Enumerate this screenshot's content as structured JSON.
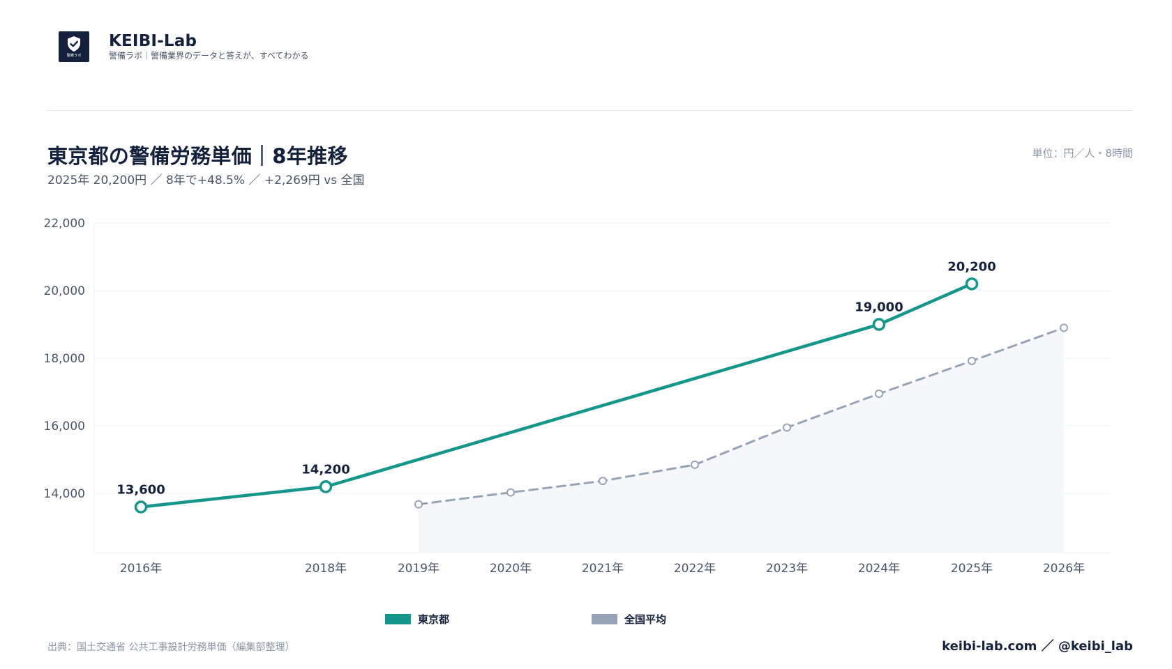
{
  "brand": {
    "name": "KEIBI-Lab",
    "tagline": "警備ラボ｜警備業界のデータと答えが、すべてわかる",
    "logo_text": "警備ラボ",
    "logo_icon": "shield-check-icon",
    "logo_bg": "#14213d"
  },
  "chart_header": {
    "title": "東京都の警備労務単価｜8年推移",
    "subtitle": "2025年 20,200円 ／ 8年で+48.5% ／ +2,269円 vs 全国",
    "unit": "単位：円／人・8時間"
  },
  "chart_data": {
    "type": "line",
    "x": [
      "2016年",
      "2018年",
      "2019年",
      "2020年",
      "2021年",
      "2022年",
      "2023年",
      "2024年",
      "2025年",
      "2026年"
    ],
    "ylim": [
      12250,
      22000
    ],
    "yticks": [
      14000,
      16000,
      18000,
      20000,
      22000
    ],
    "ytick_labels": [
      "14,000",
      "16,000",
      "18,000",
      "20,000",
      "22,000"
    ],
    "grid": true,
    "series": [
      {
        "name": "東京都",
        "color": "#14968a",
        "style": "solid",
        "points": [
          {
            "x": "2016年",
            "y": 13600,
            "label": "13,600"
          },
          {
            "x": "2018年",
            "y": 14200,
            "label": "14,200"
          },
          {
            "x": "2024年",
            "y": 19000,
            "label": "19,000"
          },
          {
            "x": "2025年",
            "y": 20200,
            "label": "20,200"
          }
        ]
      },
      {
        "name": "全国平均",
        "color": "#97a3b6",
        "style": "dashed",
        "area_fill": "#f5f7fa",
        "points": [
          {
            "x": "2019年",
            "y": 13680
          },
          {
            "x": "2020年",
            "y": 14030
          },
          {
            "x": "2021年",
            "y": 14370
          },
          {
            "x": "2022年",
            "y": 14850
          },
          {
            "x": "2023年",
            "y": 15950
          },
          {
            "x": "2024年",
            "y": 16950
          },
          {
            "x": "2025年",
            "y": 17920
          },
          {
            "x": "2026年",
            "y": 18900
          }
        ]
      }
    ],
    "legend_position": "bottom-center"
  },
  "legend": {
    "items": [
      {
        "label": "東京都",
        "color": "#14968a"
      },
      {
        "label": "全国平均",
        "color": "#97a3b6"
      }
    ]
  },
  "footer": {
    "source": "出典：国土交通省 公共工事設計労務単価（編集部整理）",
    "credit": "keibi-lab.com ／ @keibi_lab"
  }
}
